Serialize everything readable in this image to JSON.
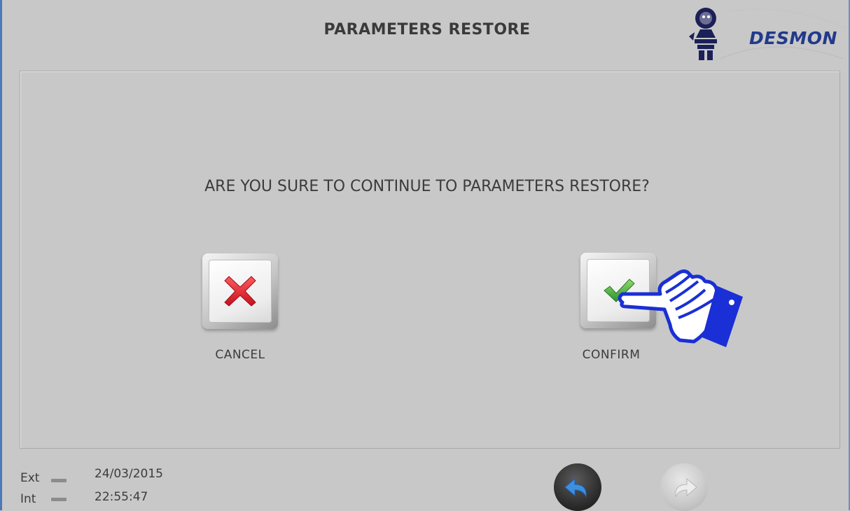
{
  "header": {
    "title": "PARAMETERS RESTORE",
    "logo_text": "DESMON"
  },
  "dialog": {
    "question": "ARE YOU SURE TO CONTINUE TO PARAMETERS RESTORE?",
    "cancel_label": "CANCEL",
    "confirm_label": "CONFIRM"
  },
  "status": {
    "ext_label": "Ext",
    "int_label": "Int",
    "date": "24/03/2015",
    "time": "22:55:47"
  },
  "icons": {
    "cancel": "x-icon",
    "confirm": "checkmark-icon",
    "pointer": "pointing-hand-icon",
    "back": "back-arrow-icon",
    "forward": "forward-arrow-icon"
  },
  "colors": {
    "background": "#c8c8c8",
    "brand": "#233a8a",
    "cancel_mark": "#e0202a",
    "confirm_mark": "#39a03c",
    "hand_cuff": "#1a2fd6",
    "back_arrow": "#3d8fe0"
  }
}
